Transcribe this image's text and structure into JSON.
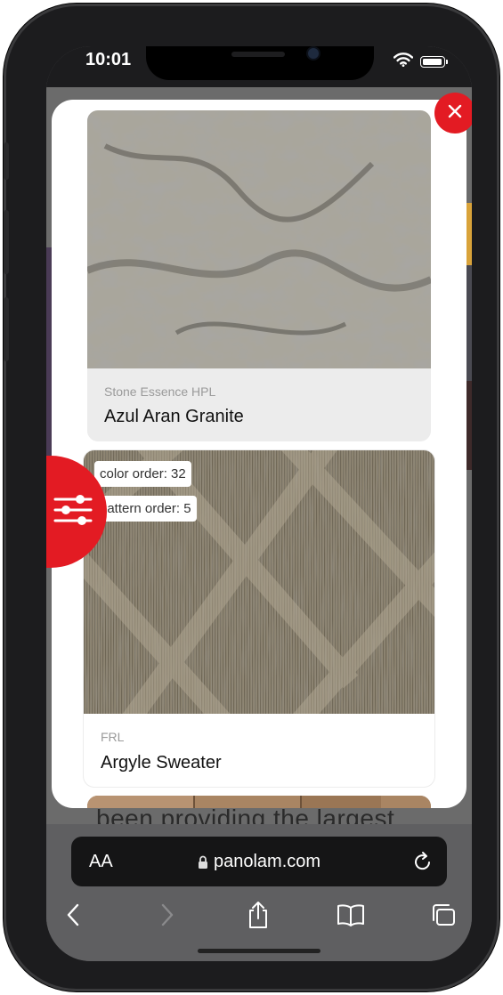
{
  "status_bar": {
    "time": "10:01"
  },
  "background_page": {
    "text_fragment": "been providing the largest"
  },
  "modal": {
    "cards": [
      {
        "category": "Stone Essence HPL",
        "name": "Azul Aran Granite"
      },
      {
        "category": "FRL",
        "name": "Argyle Sweater",
        "color_order": "color order: 32",
        "pattern_order": "pattern order: 5"
      }
    ]
  },
  "browser": {
    "text_size_label": "AA",
    "url": "panolam.com"
  },
  "icons": {
    "close": "close-icon",
    "filter": "sliders-icon",
    "lock": "lock-icon",
    "reload": "reload-icon",
    "back": "chevron-left-icon",
    "forward": "chevron-right-icon",
    "share": "share-icon",
    "bookmarks": "book-icon",
    "tabs": "tabs-icon"
  },
  "colors": {
    "accent": "#e31b23",
    "address_bar": "#151516",
    "toolbar": "#5f5f61"
  }
}
